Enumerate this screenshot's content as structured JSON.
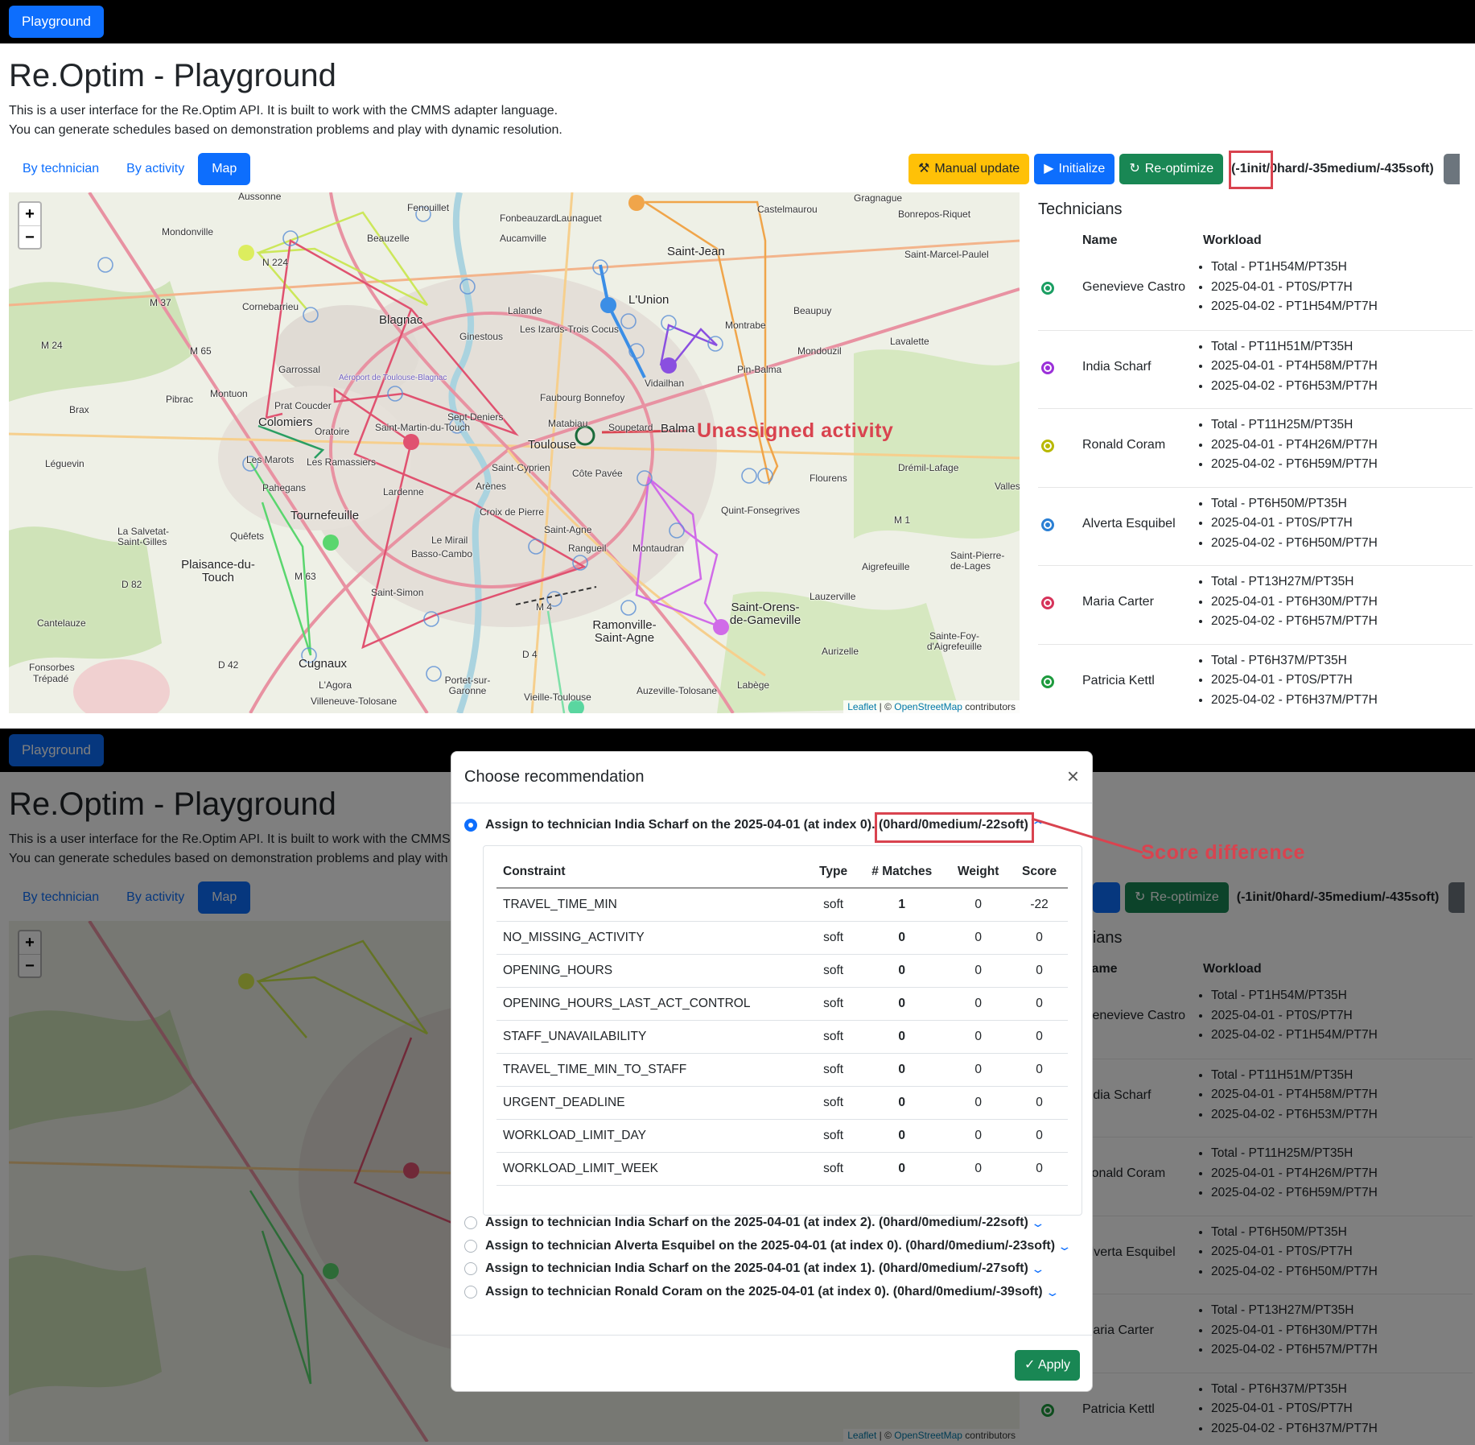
{
  "brand": "Playground",
  "title": "Re.Optim - Playground",
  "description": [
    "This is a user interface for the Re.Optim API. It is built to work with the CMMS adapter language.",
    "You can generate schedules based on demonstration problems and play with dynamic resolution."
  ],
  "tabs": [
    "By technician",
    "By activity",
    "Map"
  ],
  "toolbar": {
    "manual_update": "Manual update",
    "initialize": "Initialize",
    "reoptimize": "Re-optimize",
    "score": "(-1init/0hard/-35medium/-435soft)"
  },
  "map": {
    "zoom_in": "+",
    "zoom_out": "−",
    "attribution_leaflet": "Leaflet",
    "attribution_sep": " | © ",
    "attribution_osm": "OpenStreetMap",
    "attribution_tail": " contributors",
    "places": [
      "Aussonne",
      "Fenouillet",
      "Gragnague",
      "Castelmaurou",
      "Bonrepos-Riquet",
      "Fonbeauzard",
      "Launaguet",
      "Mondonville",
      "Beauzelle",
      "Aucamville",
      "Saint-Jean",
      "Saint-Marcel-Paulel",
      "N 224",
      "Cornebarrieu",
      "Blagnac",
      "M 37",
      "L'Union",
      "Lalande",
      "Les Izards-Trois Cocus",
      "Beaupuy",
      "Montrabe",
      "M 24",
      "M 65",
      "Ginestous",
      "Lavalette",
      "Garrossal",
      "Mondouzil",
      "Pin-Balma",
      "Aéroport de Toulouse-Blagnac",
      "Montuon",
      "Faubourg Bonnefoy",
      "Pibrac",
      "Brax",
      "Prat Coucder",
      "Sept Deniers",
      "Vidailhan",
      "Colomiers",
      "Oratoire",
      "Saint-Martin-du-Touch",
      "Matabiau",
      "Soupetard",
      "Balma",
      "Toulouse",
      "Léguevin",
      "Les Marots",
      "Les Ramassiers",
      "Saint-Cyprien",
      "Côte Pavée",
      "Drémil-Lafage",
      "Pahegans",
      "Lardenne",
      "Arènes",
      "Flourens",
      "Vallesvilles",
      "Tournefeuille",
      "Croix de Pierre",
      "Quint-Fonsegrives",
      "La Salvetat-Saint-Gilles",
      "Quêfets",
      "Saint-Agne",
      "M 1",
      "Le Mirail",
      "Basso-Cambo",
      "Rangueil",
      "Montaudran",
      "Plaisance-du-Touch",
      "M 63",
      "Aigrefeuille",
      "Saint-Pierre-de-Lages",
      "D 82",
      "Saint-Simon",
      "Lauzerville",
      "Saint-Orens-de-Gameville",
      "M 4",
      "Cantelauze",
      "Ramonville-Saint-Agne",
      "Sainte-Foy-d'Aigrefeuille",
      "Fonsorbes",
      "Trépadé",
      "D 42",
      "D 4",
      "Cugnaux",
      "Aurizelle",
      "L'Agora",
      "Labège",
      "Villeneuve-Tolosane",
      "Portet-sur-Garonne",
      "Vieille-Toulouse",
      "Auzeville-Tolosane"
    ]
  },
  "annotations": {
    "unassigned": "Unassigned activity",
    "score_diff": "Score difference"
  },
  "technicians": {
    "title": "Technicians",
    "col_name": "Name",
    "col_workload": "Workload",
    "rows": [
      {
        "name": "Genevieve Castro",
        "color": "#1a9e62",
        "workload": [
          "Total - PT1H54M/PT35H",
          "2025-04-01 - PT0S/PT7H",
          "2025-04-02 - PT1H54M/PT7H"
        ]
      },
      {
        "name": "India Scharf",
        "color": "#9b30d9",
        "workload": [
          "Total - PT11H51M/PT35H",
          "2025-04-01 - PT4H58M/PT7H",
          "2025-04-02 - PT6H53M/PT7H"
        ]
      },
      {
        "name": "Ronald Coram",
        "color": "#b8b800",
        "workload": [
          "Total - PT11H25M/PT35H",
          "2025-04-01 - PT4H26M/PT7H",
          "2025-04-02 - PT6H59M/PT7H"
        ]
      },
      {
        "name": "Alverta Esquibel",
        "color": "#2a7fd4",
        "workload": [
          "Total - PT6H50M/PT35H",
          "2025-04-01 - PT0S/PT7H",
          "2025-04-02 - PT6H50M/PT7H"
        ]
      },
      {
        "name": "Maria Carter",
        "color": "#d6335a",
        "workload": [
          "Total - PT13H27M/PT35H",
          "2025-04-01 - PT6H30M/PT7H",
          "2025-04-02 - PT6H57M/PT7H"
        ]
      },
      {
        "name": "Patricia Kettl",
        "color": "#1d9a3d",
        "workload": [
          "Total - PT6H37M/PT35H",
          "2025-04-01 - PT0S/PT7H",
          "2025-04-02 - PT6H37M/PT7H"
        ]
      }
    ]
  },
  "modal": {
    "title": "Choose recommendation",
    "close": "×",
    "recommendations": [
      {
        "text": "Assign to technician India Scharf on the 2025-04-01 (at index 0).",
        "score": "(0hard/0medium/-22soft)",
        "selected": true
      },
      {
        "text": "Assign to technician India Scharf on the 2025-04-01 (at index 2).",
        "score": "(0hard/0medium/-22soft)",
        "selected": false
      },
      {
        "text": "Assign to technician Alverta Esquibel on the 2025-04-01 (at index 0).",
        "score": "(0hard/0medium/-23soft)",
        "selected": false
      },
      {
        "text": "Assign to technician India Scharf on the 2025-04-01 (at index 1).",
        "score": "(0hard/0medium/-27soft)",
        "selected": false
      },
      {
        "text": "Assign to technician Ronald Coram on the 2025-04-01 (at index 0).",
        "score": "(0hard/0medium/-39soft)",
        "selected": false
      }
    ],
    "table": {
      "headers": [
        "Constraint",
        "Type",
        "# Matches",
        "Weight",
        "Score"
      ],
      "rows": [
        [
          "TRAVEL_TIME_MIN",
          "soft",
          "1",
          "0",
          "-22"
        ],
        [
          "NO_MISSING_ACTIVITY",
          "soft",
          "0",
          "0",
          "0"
        ],
        [
          "OPENING_HOURS",
          "soft",
          "0",
          "0",
          "0"
        ],
        [
          "OPENING_HOURS_LAST_ACT_CONTROL",
          "soft",
          "0",
          "0",
          "0"
        ],
        [
          "STAFF_UNAVAILABILITY",
          "soft",
          "0",
          "0",
          "0"
        ],
        [
          "TRAVEL_TIME_MIN_TO_STAFF",
          "soft",
          "0",
          "0",
          "0"
        ],
        [
          "URGENT_DEADLINE",
          "soft",
          "0",
          "0",
          "0"
        ],
        [
          "WORKLOAD_LIMIT_DAY",
          "soft",
          "0",
          "0",
          "0"
        ],
        [
          "WORKLOAD_LIMIT_WEEK",
          "soft",
          "0",
          "0",
          "0"
        ]
      ]
    },
    "apply": "Apply"
  }
}
